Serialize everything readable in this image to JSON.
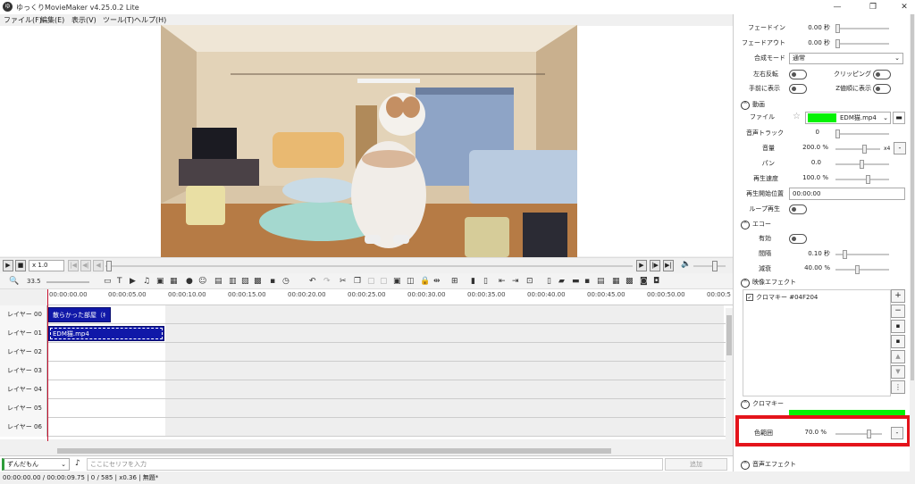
{
  "window": {
    "title": "ゆっくりMovieMaker v4.25.0.2 Lite",
    "app_icon": "ゆ"
  },
  "menu": [
    {
      "label": "ファイル(F)"
    },
    {
      "label": "編集(E)"
    },
    {
      "label": "表示(V)"
    },
    {
      "label": "ツール(T)"
    },
    {
      "label": "ヘルプ(H)"
    }
  ],
  "playback": {
    "speed": "x 1.0"
  },
  "toolbar": {
    "zoom": "33.5"
  },
  "ruler": {
    "ticks": [
      "00:00:00.00",
      "00:00:05.00",
      "00:00:10.00",
      "00:00:15.00",
      "00:00:20.00",
      "00:00:25.00",
      "00:00:30.00",
      "00:00:35.00",
      "00:00:40.00",
      "00:00:45.00",
      "00:00:50.00",
      "00:00:5"
    ]
  },
  "layers": [
    {
      "label": "レイヤー 00",
      "clip": "散らかった部屋（ｷ"
    },
    {
      "label": "レイヤー 01",
      "clip": "EDM猫.mp4"
    },
    {
      "label": "レイヤー 02",
      "clip": ""
    },
    {
      "label": "レイヤー 03",
      "clip": ""
    },
    {
      "label": "レイヤー 04",
      "clip": ""
    },
    {
      "label": "レイヤー 05",
      "clip": ""
    },
    {
      "label": "レイヤー 06",
      "clip": ""
    }
  ],
  "input": {
    "character": "ずんだもん",
    "placeholder": "ここにセリフを入力",
    "add": "追加"
  },
  "status": {
    "text": "00:00:00.00 / 00:00:09.75 | 0 / 585 | x0.36 | 無題*"
  },
  "panel": {
    "fade_in": {
      "label": "フェードイン",
      "value": "0.00 秒"
    },
    "fade_out": {
      "label": "フェードアウト",
      "value": "0.00 秒"
    },
    "blend": {
      "label": "合成モード",
      "value": "通常"
    },
    "flip": {
      "label": "左右反転"
    },
    "clipping": {
      "label": "クリッピング"
    },
    "front": {
      "label": "手前に表示"
    },
    "zorder": {
      "label": "Z値順に表示"
    },
    "video_section": "動画",
    "file": {
      "label": "ファイル",
      "value": "EDM猫.mp4"
    },
    "audio_track": {
      "label": "音声トラック",
      "value": "0"
    },
    "volume": {
      "label": "音量",
      "value": "200.0 %",
      "suffix": "x4"
    },
    "pan": {
      "label": "パン",
      "value": "0.0"
    },
    "speed": {
      "label": "再生速度",
      "value": "100.0 %"
    },
    "start_pos": {
      "label": "再生開始位置",
      "value": "00:00:00"
    },
    "loop": {
      "label": "ループ再生"
    },
    "echo_section": "エコー",
    "echo_enabled": {
      "label": "有効"
    },
    "interval": {
      "label": "間隔",
      "value": "0.10 秒"
    },
    "decay": {
      "label": "減衰",
      "value": "40.00 %"
    },
    "video_effect_section": "映像エフェクト",
    "effect_item": "クロマキー #04F204",
    "chroma_section": "クロマキー",
    "color_range": {
      "label": "色範囲",
      "value": "70.0 %"
    },
    "audio_effect_section": "音声エフェクト",
    "chroma_color": "#04F204",
    "highlight_color": "#e4141b"
  }
}
